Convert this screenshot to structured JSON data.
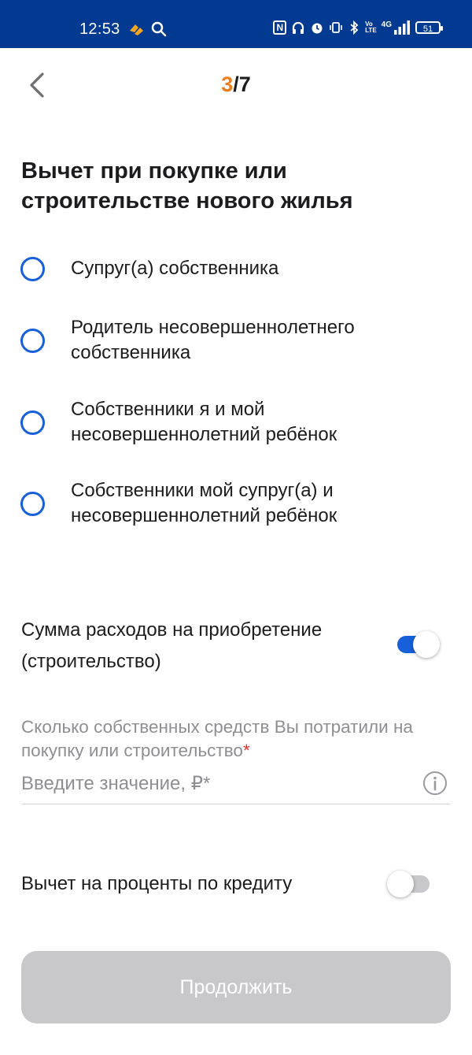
{
  "status_bar": {
    "time": "12:53",
    "nfc": "N",
    "net": "4G",
    "battery": "51",
    "icons": [
      "app-logo-icon",
      "search-icon",
      "nfc-icon",
      "headphones-icon",
      "alarm-icon",
      "vibrate-icon",
      "bluetooth-icon",
      "volte-icon",
      "signal-icon",
      "battery-icon"
    ]
  },
  "header": {
    "back_icon": "chevron-left-icon",
    "step_current": "3",
    "step_total": "/7"
  },
  "title": "Вычет при покупке или строительстве нового жилья",
  "options": [
    {
      "label": "Супруг(а) собственника",
      "selected": false
    },
    {
      "label": "Родитель несовершеннолетнего собственника",
      "selected": false
    },
    {
      "label": "Собственники я и мой несовершеннолетний ребёнок",
      "selected": false
    },
    {
      "label": "Собственники мой супруг(а) и несовершеннолетний ребёнок",
      "selected": false
    }
  ],
  "expenses": {
    "label": "Сумма расходов на приобретение (строительство)",
    "enabled": true
  },
  "own_funds": {
    "hint": "Сколько собственных средств Вы потратили на покупку или строительство",
    "required_mark": "*",
    "placeholder": "Введите значение, ₽*",
    "value": ""
  },
  "interest": {
    "label": "Вычет на проценты по кредиту",
    "enabled": false
  },
  "continue_label": "Продолжить",
  "colors": {
    "status_bar": "#033a91",
    "accent": "#1760d9",
    "step_highlight": "#ef7d1a",
    "required": "#e4322f",
    "button_disabled": "#c8c8cb"
  }
}
